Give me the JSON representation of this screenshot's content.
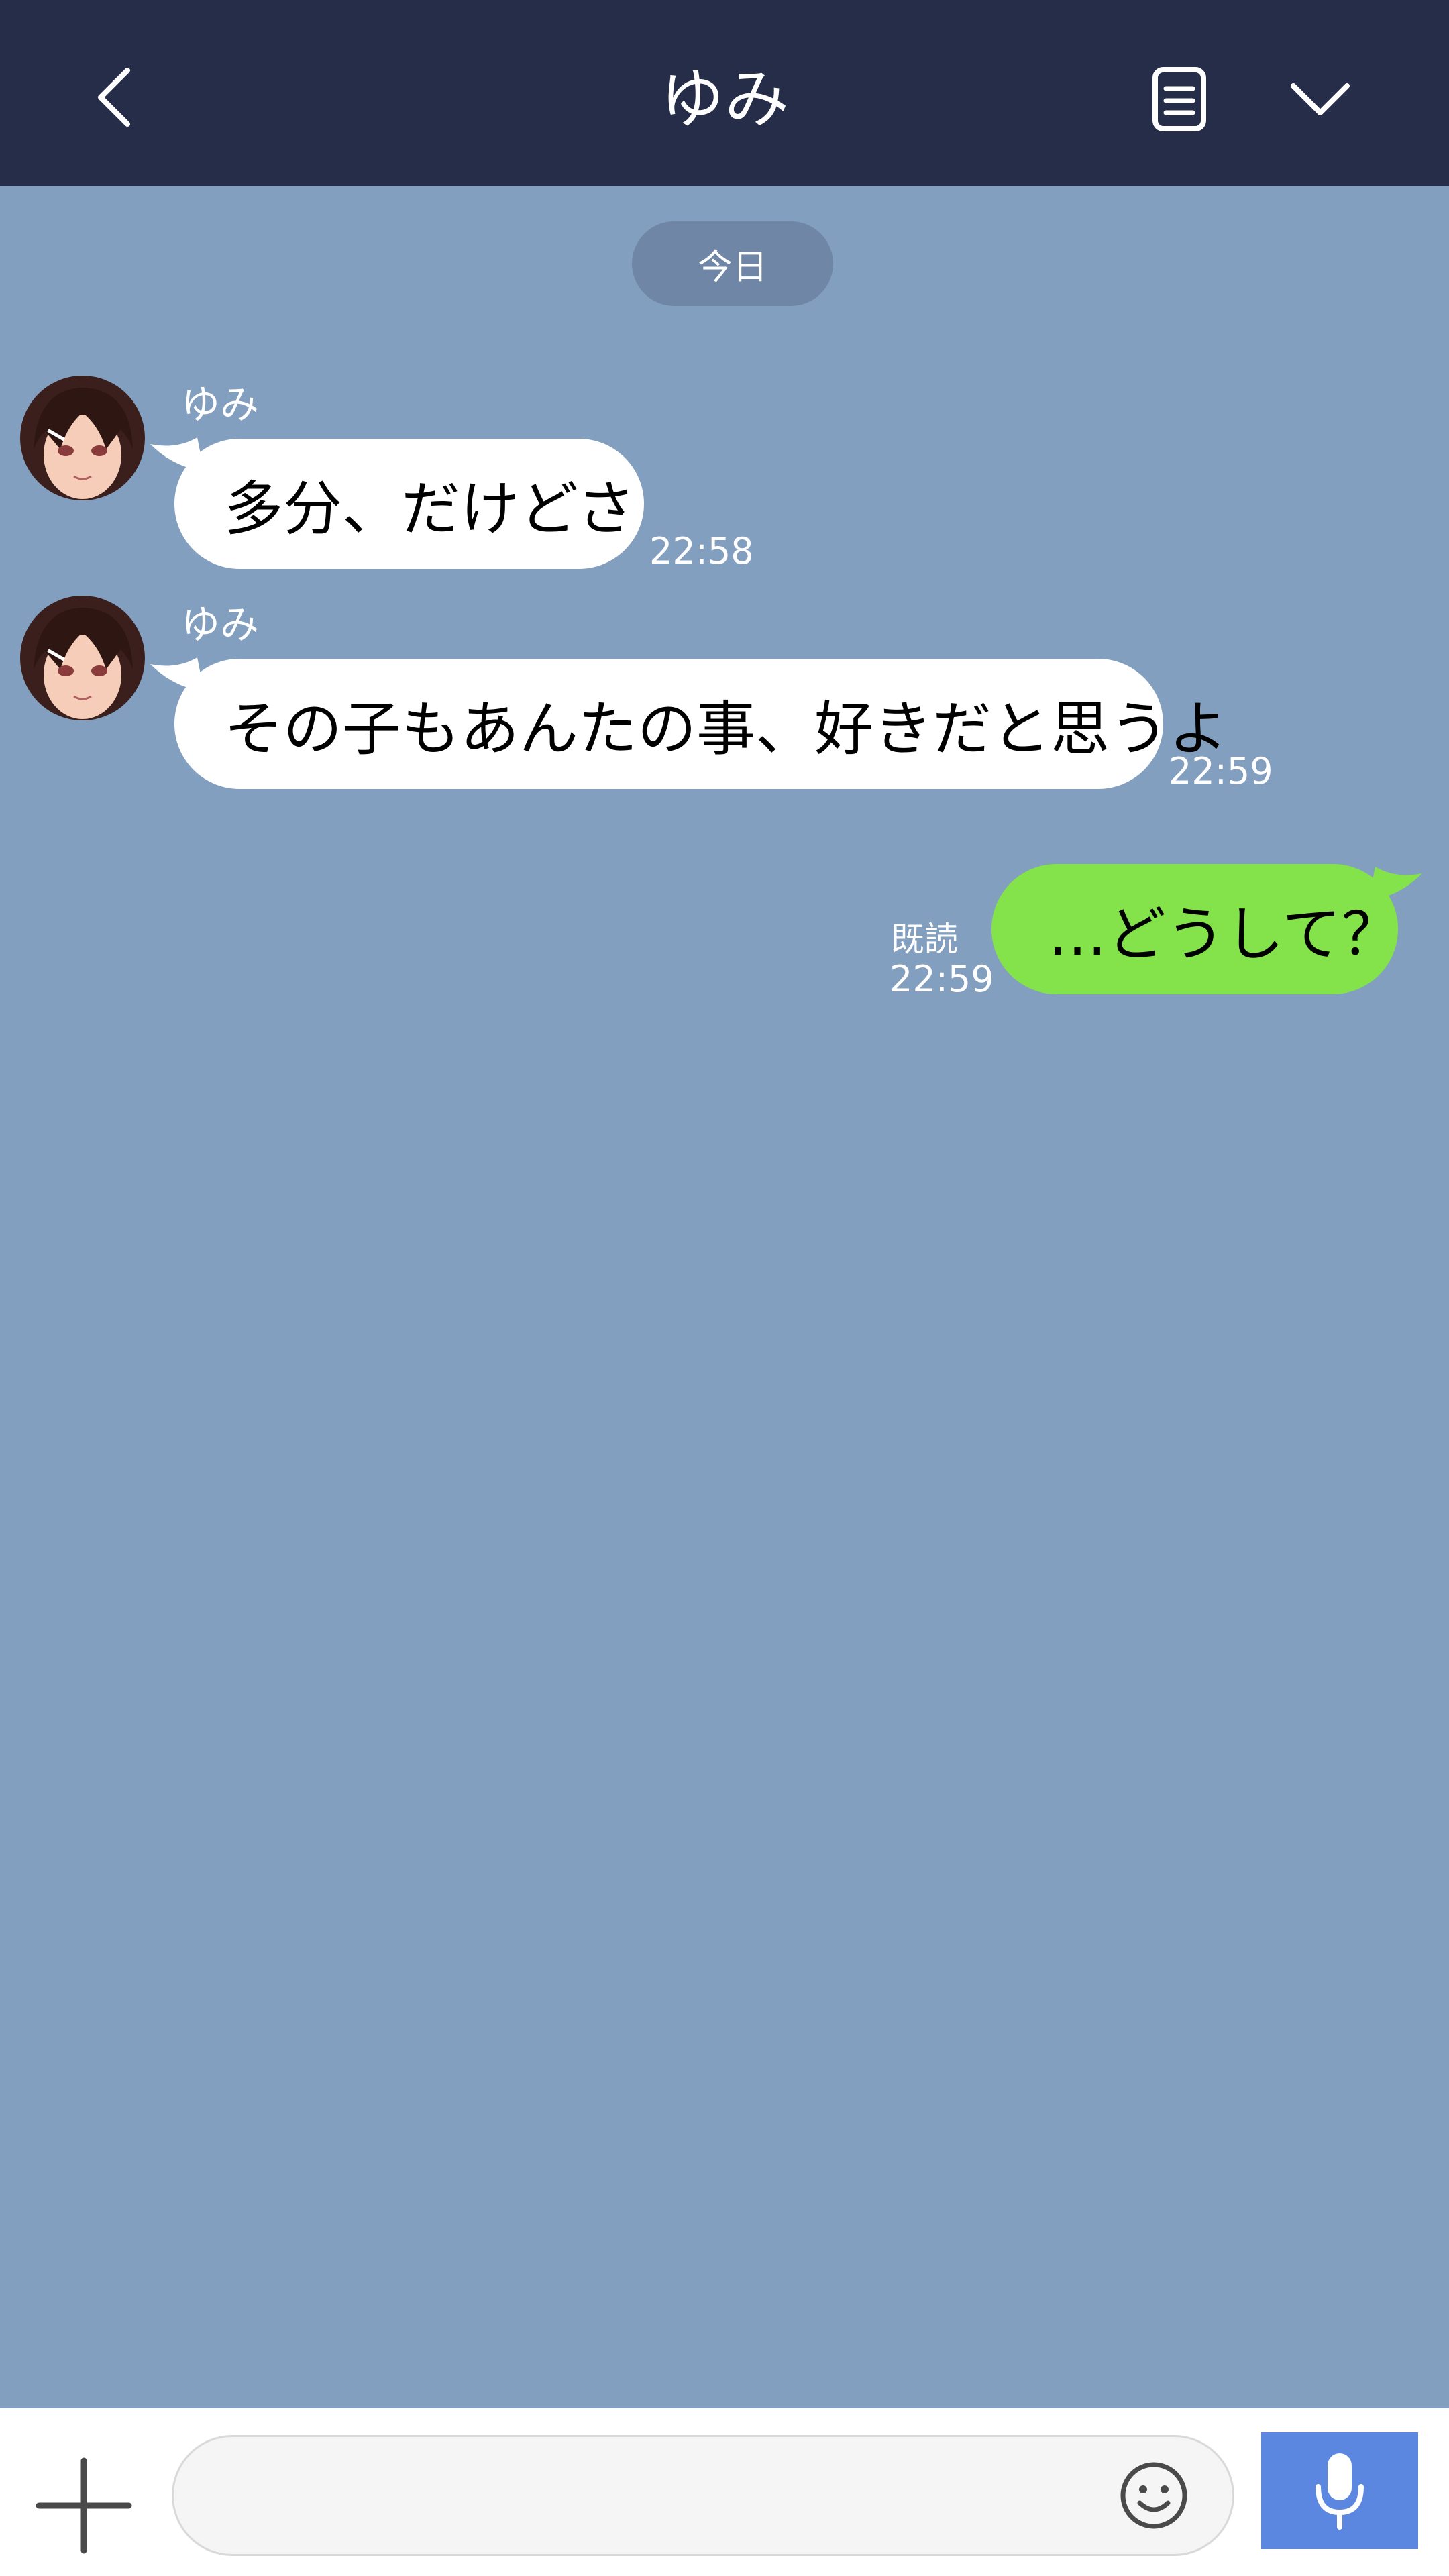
{
  "header": {
    "title": "ゆみ",
    "back_icon": "chevron-left-icon",
    "notes_icon": "note-icon",
    "menu_icon": "chevron-down-icon"
  },
  "date_separator": "今日",
  "messages": [
    {
      "sender": "ゆみ",
      "text": "多分、だけどさ",
      "time": "22:58"
    },
    {
      "sender": "ゆみ",
      "text": "その子もあんたの事、好きだと思うよ",
      "time": "22:59"
    },
    {
      "text": "…どうして？",
      "read": "既読",
      "time": "22:59"
    }
  ],
  "input": {
    "value": "",
    "placeholder": "",
    "plus_icon": "plus-icon",
    "emoji_icon": "smiley-icon",
    "mic_icon": "microphone-icon"
  },
  "colors": {
    "header_bg": "#252d48",
    "chat_bg": "#839fbf",
    "incoming_bubble": "#ffffff",
    "outgoing_bubble": "#84e24a",
    "mic_button": "#5b87e0"
  }
}
